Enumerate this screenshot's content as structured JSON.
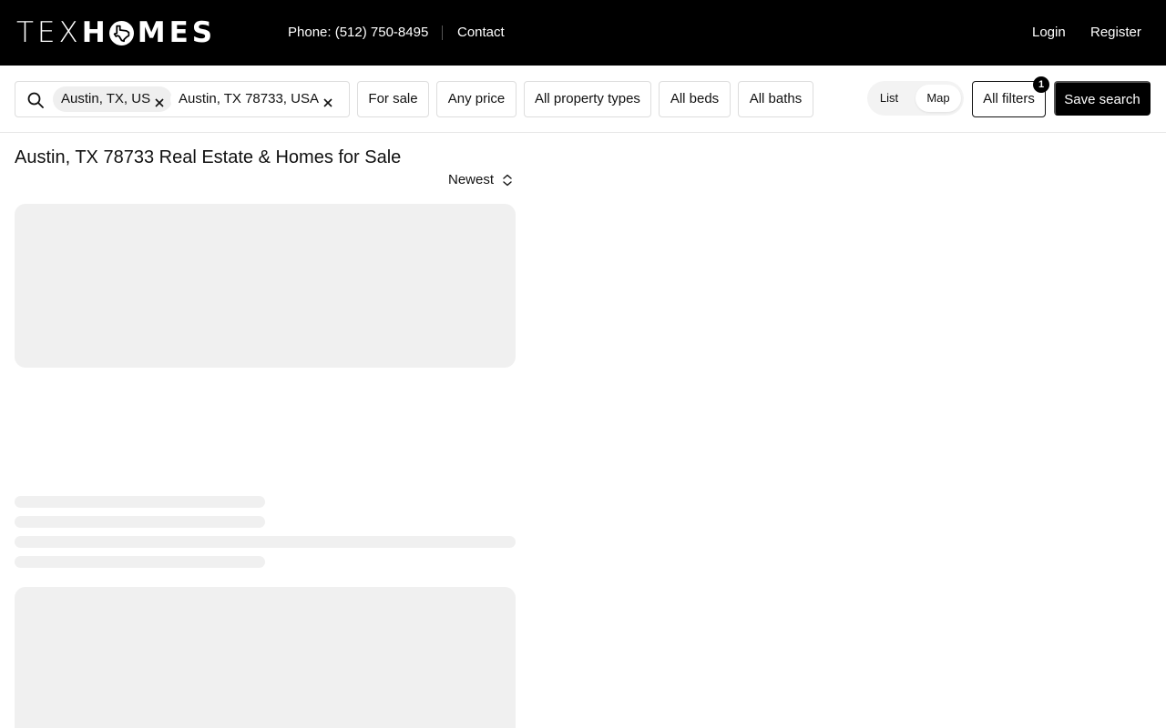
{
  "header": {
    "logo_text_light": "TEX",
    "logo_text_bold_h": "H",
    "logo_text_bold_rest": "MES",
    "phone": "Phone: (512) 750-8495",
    "contact": "Contact",
    "login": "Login",
    "register": "Register"
  },
  "filters": {
    "chips": [
      "Austin, TX, US",
      "Austin, TX 78733, USA"
    ],
    "listing_type": "For sale",
    "price": "Any price",
    "property_types": "All property types",
    "beds": "All beds",
    "baths": "All baths",
    "view_toggle": {
      "list": "List",
      "map": "Map",
      "active": "map"
    },
    "all_filters": "All filters",
    "all_filters_count": "1",
    "save_search": "Save search"
  },
  "main": {
    "title": "Austin, TX 78733 Real Estate & Homes for Sale",
    "sort_label": "Newest"
  },
  "colors": {
    "header_bg": "#000000",
    "skeleton": "#f0f0f0",
    "primary_button": "#000000"
  }
}
